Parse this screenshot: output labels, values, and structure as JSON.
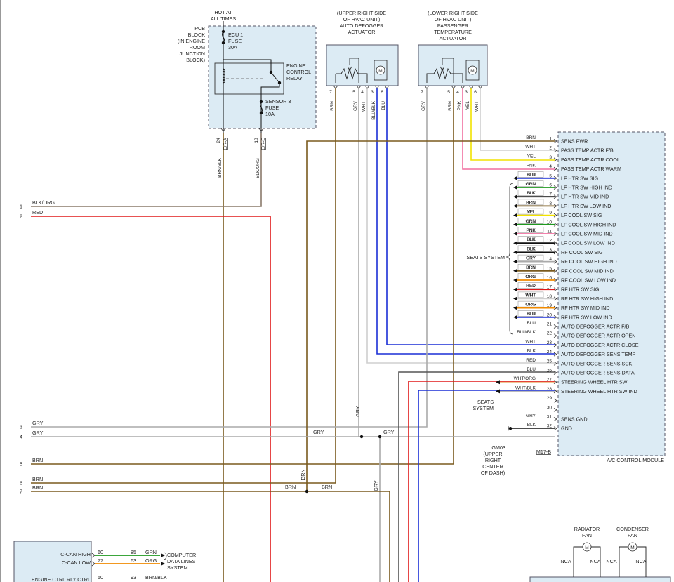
{
  "hot_label": [
    "HOT AT",
    "ALL TIMES"
  ],
  "pcb_label": [
    "PCB",
    "BLOCK",
    "(IN ENGINE",
    "ROOM",
    "JUNCTION",
    "BLOCK)"
  ],
  "ecu1": [
    "ECU 1",
    "FUSE",
    "30A"
  ],
  "relay": [
    "ENGINE",
    "CONTROL",
    "RELAY"
  ],
  "sensor3": [
    "SENSOR 3",
    "FUSE",
    "10A"
  ],
  "pcb_pins": [
    {
      "num": "24",
      "conn": "E/R-A",
      "wire": "BRN/BLK"
    },
    {
      "num": "18",
      "conn": "E/R-E",
      "wire": "BLK/ORG"
    }
  ],
  "defog_title": [
    "(UPPER RIGHT SIDE",
    "OF HVAC UNIT)",
    "AUTO DEFOGGER",
    "ACTUATOR"
  ],
  "defog_pins": [
    {
      "num": "7",
      "wire": "BRN"
    },
    {
      "num": "5",
      "wire": "GRY"
    },
    {
      "num": "4",
      "wire": "WHT"
    },
    {
      "num": "3",
      "wire": "BLU/BLK"
    },
    {
      "num": "6",
      "wire": "BLU"
    }
  ],
  "temp_title": [
    "(LOWER RIGHT SIDE",
    "OF HVAC UNIT)",
    "PASSENGER",
    "TEMPERATURE",
    "ACTUATOR"
  ],
  "temp_pins": [
    {
      "num": "7",
      "wire": "GRY"
    },
    {
      "num": "5",
      "wire": "BRN"
    },
    {
      "num": "4",
      "wire": "PNK"
    },
    {
      "num": "3",
      "wire": "YEL"
    },
    {
      "num": "6",
      "wire": "WHT"
    }
  ],
  "motor_symbol": "M",
  "module_name": "A/C CONTROL MODULE",
  "module_connector": "M17-B",
  "module_pins": [
    {
      "num": "1",
      "color": "BRN",
      "label": "SENS PWR"
    },
    {
      "num": "2",
      "color": "WHT",
      "label": "PASS TEMP ACTR F/B"
    },
    {
      "num": "3",
      "color": "YEL",
      "label": "PASS TEMP ACTR COOL"
    },
    {
      "num": "4",
      "color": "PNK",
      "label": "PASS TEMP ACTR WARM"
    },
    {
      "num": "5",
      "color": "BLU",
      "label": "LF HTR SW SIG"
    },
    {
      "num": "6",
      "color": "GRN",
      "label": "LF HTR SW HIGH IND"
    },
    {
      "num": "7",
      "color": "BLK",
      "label": "LF HTR SW MID IND"
    },
    {
      "num": "8",
      "color": "BRN",
      "label": "LF HTR SW LOW IND"
    },
    {
      "num": "9",
      "color": "YEL",
      "label": "LF COOL SW SIG"
    },
    {
      "num": "10",
      "color": "GRN",
      "label": "LF COOL SW HIGH IND"
    },
    {
      "num": "11",
      "color": "PNK",
      "label": "LF COOL SW MID IND"
    },
    {
      "num": "12",
      "color": "BLK",
      "label": "LF COOL SW LOW IND"
    },
    {
      "num": "13",
      "color": "BLK",
      "label": "RF COOL SW SIG"
    },
    {
      "num": "14",
      "color": "GRY",
      "label": "RF COOL SW HIGH IND"
    },
    {
      "num": "15",
      "color": "BRN",
      "label": "RF COOL SW MID IND"
    },
    {
      "num": "16",
      "color": "ORG",
      "label": "RF COOL SW LOW IND"
    },
    {
      "num": "17",
      "color": "RED",
      "label": "RF HTR SW SIG"
    },
    {
      "num": "18",
      "color": "WHT",
      "label": "RF HTR SW HIGH IND"
    },
    {
      "num": "19",
      "color": "ORG",
      "label": "RF HTR SW MID IND"
    },
    {
      "num": "20",
      "color": "BLU",
      "label": "RF HTR SW LOW IND"
    },
    {
      "num": "21",
      "color": "BLU",
      "label": "AUTO DEFOGGER ACTR F/B"
    },
    {
      "num": "22",
      "color": "BLU/BLK",
      "label": "AUTO DEFOGGER ACTR OPEN"
    },
    {
      "num": "23",
      "color": "WHT",
      "label": "AUTO DEFOGGER ACTR CLOSE"
    },
    {
      "num": "24",
      "color": "BLK",
      "label": "AUTO DEFOGGER SENS TEMP"
    },
    {
      "num": "25",
      "color": "RED",
      "label": "AUTO DEFOGGER SENS SCK"
    },
    {
      "num": "26",
      "color": "BLU",
      "label": "AUTO DEFOGGER SENS DATA"
    },
    {
      "num": "27",
      "color": "WHT/ORG",
      "label": "STEERING WHEEL HTR SW"
    },
    {
      "num": "28",
      "color": "WHT/BLK",
      "label": "STEERING WHEEL HTR SW IND"
    },
    {
      "num": "29",
      "color": "",
      "label": ""
    },
    {
      "num": "30",
      "color": "",
      "label": ""
    },
    {
      "num": "31",
      "color": "GRY",
      "label": "SENS GND"
    },
    {
      "num": "32",
      "color": "BLK",
      "label": "GND"
    }
  ],
  "seats_system_label": "SEATS SYSTEM",
  "seats_system2": [
    "SEATS",
    "SYSTEM"
  ],
  "ground": {
    "id": "GM03",
    "location": [
      "(UPPER",
      "RIGHT",
      "CENTER",
      "OF DASH)"
    ]
  },
  "left_wires": [
    {
      "num": "1",
      "color": "BLK/ORG"
    },
    {
      "num": "2",
      "color": "RED"
    },
    {
      "num": "3",
      "color": "GRY"
    },
    {
      "num": "4",
      "color": "GRY"
    },
    {
      "num": "5",
      "color": "BRN"
    },
    {
      "num": "6",
      "color": "BRN"
    },
    {
      "num": "7",
      "color": "BRN"
    }
  ],
  "inline_labels": {
    "gry4a": "GRY",
    "gry4b": "GRY",
    "gry_vert1": "GRY",
    "gry_vert2": "GRY",
    "brn_vert": "BRN",
    "brn7a": "BRN",
    "brn7b": "BRN"
  },
  "ecm": {
    "rows": [
      {
        "label": "C-CAN HIGH",
        "pin1": "60",
        "pin2": "85",
        "color": "GRN"
      },
      {
        "label": "C-CAN LOW",
        "pin1": "77",
        "pin2": "63",
        "color": "ORG"
      },
      {
        "label": "ENGINE CTRL RLY CTRL",
        "pin1": "50",
        "pin2": "93",
        "color": "BRN/BLK"
      }
    ],
    "computer_lines": [
      "COMPUTER",
      "DATA LINES",
      "SYSTEM"
    ]
  },
  "fans": {
    "radiator": [
      "RADIATOR",
      "FAN"
    ],
    "condenser": [
      "CONDENSER",
      "FAN"
    ],
    "nca": "NCA"
  },
  "colors": {
    "BRN": "#7a5a1e",
    "WHT": "#cfcfcf",
    "YEL": "#f2e200",
    "PNK": "#f06fa0",
    "BLU": "#1a2fd6",
    "GRN": "#1f9a1f",
    "BLK": "#111111",
    "GRY": "#aaaaaa",
    "ORG": "#f08a00",
    "RED": "#e01818",
    "BLU/BLK": "#1a2fd6",
    "BRN/BLK": "#7a5a1e",
    "BLK/ORG": "#8a7a6a",
    "WHT/ORG": "#e8b070",
    "WHT/BLK": "#bbbbbb"
  }
}
